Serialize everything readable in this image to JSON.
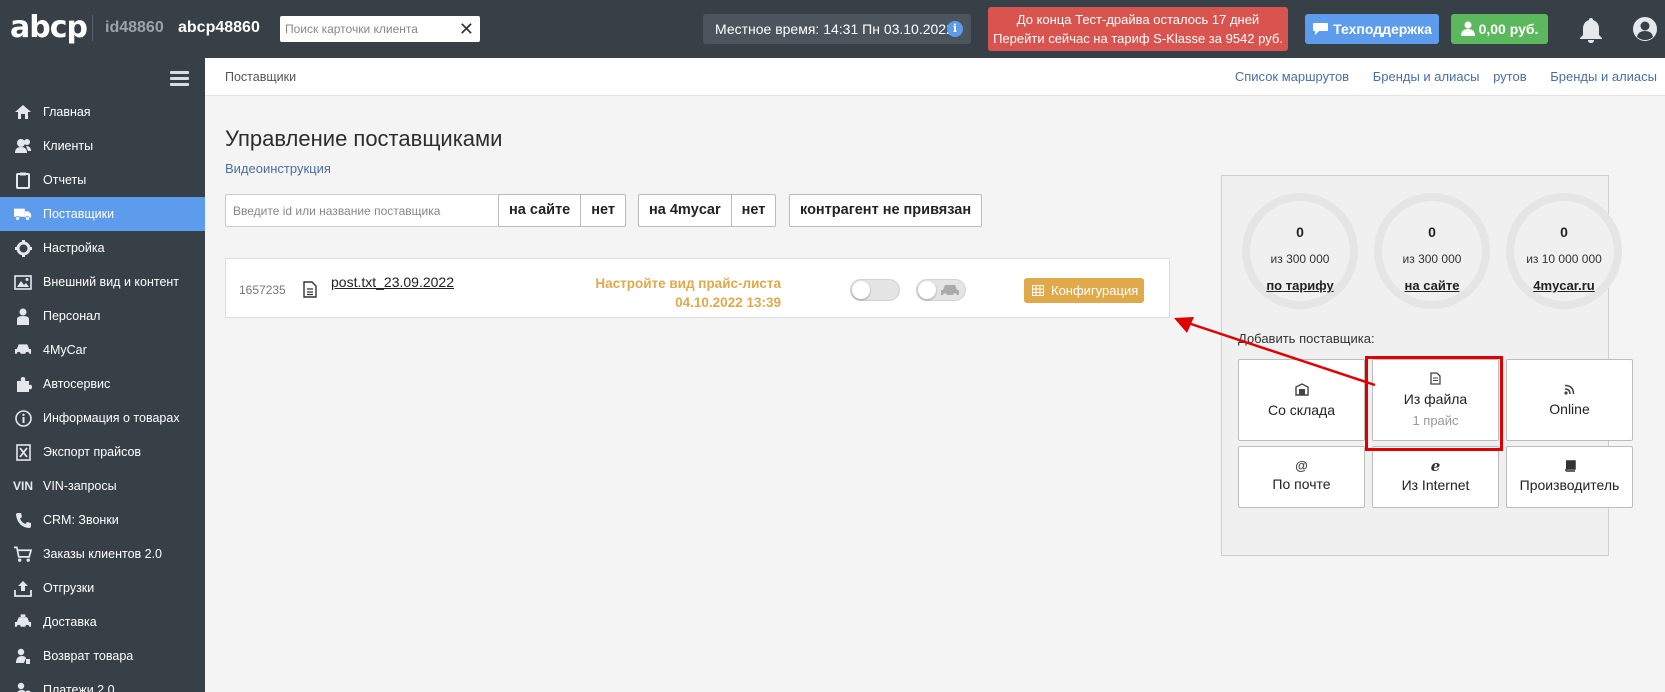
{
  "header": {
    "logo": "abcp",
    "account_id": "id48860",
    "account_name": "abcp48860",
    "search": {
      "placeholder": "Поиск карточки клиента",
      "value": ""
    },
    "local_time": "Местное время: 14:31  Пн  03.10.2022",
    "trial": {
      "line1": "До конца Тест-драйва осталось 17 дней",
      "line2": "Перейти сейчас на тариф S-Klasse за 9542 руб."
    },
    "support_label": "Техподдержка",
    "balance_label": "0,00 руб."
  },
  "sidebar": {
    "items": [
      {
        "label": "Главная",
        "icon": "home-icon"
      },
      {
        "label": "Клиенты",
        "icon": "users-icon"
      },
      {
        "label": "Отчеты",
        "icon": "clipboard-icon"
      },
      {
        "label": "Поставщики",
        "icon": "truck-icon",
        "active": true
      },
      {
        "label": "Настройка",
        "icon": "gear-icon"
      },
      {
        "label": "Внешний вид и контент",
        "icon": "image-icon"
      },
      {
        "label": "Персонал",
        "icon": "person-icon"
      },
      {
        "label": "4MyCar",
        "icon": "car-icon"
      },
      {
        "label": "Автосервис",
        "icon": "puzzle-icon"
      },
      {
        "label": "Информация о товарах",
        "icon": "info-icon"
      },
      {
        "label": "Экспорт прайсов",
        "icon": "excel-icon"
      },
      {
        "label": "VIN-запросы",
        "icon": "vin-icon"
      },
      {
        "label": "CRM: Звонки",
        "icon": "phone-icon"
      },
      {
        "label": "Заказы клиентов 2.0",
        "icon": "cart-icon"
      },
      {
        "label": "Отгрузки",
        "icon": "upload-icon"
      },
      {
        "label": "Доставка",
        "icon": "taxi-icon"
      },
      {
        "label": "Возврат товара",
        "icon": "return-icon"
      },
      {
        "label": "Платежи 2.0",
        "icon": "payment-icon"
      }
    ]
  },
  "breadcrumb": "Поставщики",
  "top_links": [
    "Список маршрутов",
    "Бренды и алиасы",
    "рутов",
    "Бренды и алиасы"
  ],
  "page": {
    "title": "Управление поставщиками",
    "video_link": "Видеоинструкция",
    "filter_placeholder": "Введите id или название поставщика",
    "filters": {
      "site": [
        "на сайте",
        "нет"
      ],
      "mycar": [
        "на 4mycar",
        "нет"
      ],
      "contractor": "контрагент не привязан"
    }
  },
  "supplier": {
    "id": "1657235",
    "file": "post.txt_23.09.2022",
    "status_line1": "Настройте вид прайс-листа",
    "status_line2": "04.10.2022  13:39",
    "config_label": "Конфигурация"
  },
  "stats": [
    {
      "value": "0",
      "of": "из 300 000",
      "label": "по тарифу"
    },
    {
      "value": "0",
      "of": "из 300 000",
      "label": "на сайте"
    },
    {
      "value": "0",
      "of": "из 10 000 000",
      "label": "4mycar.ru"
    }
  ],
  "add_supplier": {
    "title": "Добавить поставщика:",
    "tiles": [
      {
        "label": "Со склада",
        "icon": "warehouse-icon"
      },
      {
        "label": "Из файла",
        "sub": "1 прайс",
        "icon": "file-icon"
      },
      {
        "label": "Online",
        "icon": "rss-icon"
      },
      {
        "label": "По почте",
        "icon": "at-icon"
      },
      {
        "label": "Из Internet",
        "icon": "ie-icon"
      },
      {
        "label": "Производитель",
        "icon": "book-icon"
      }
    ]
  },
  "colors": {
    "topbar": "#384047",
    "sidebar_active": "#5d9cec",
    "trial": "#d9534f",
    "support": "#5d9cec",
    "balance": "#5cb85c",
    "accent_orange": "#e0a94a",
    "highlight_red": "#e10000"
  }
}
